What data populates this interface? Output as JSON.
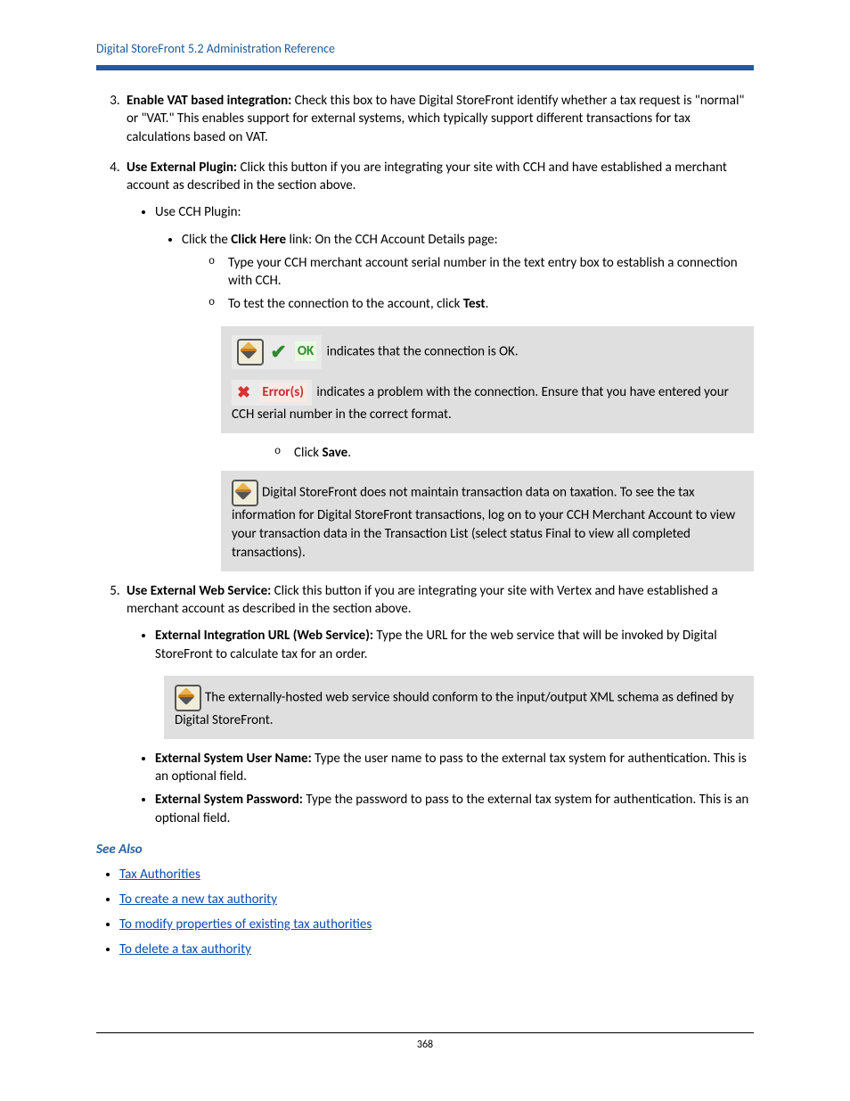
{
  "header": {
    "title": "Digital StoreFront 5.2 Administration Reference"
  },
  "item3": {
    "label": "Enable VAT based integration:",
    "text": " Check this box to have Digital StoreFront identify whether a tax request is \"normal\" or \"VAT.\" This enables support for external systems, which typically support different transactions for tax calculations based on VAT."
  },
  "item4": {
    "label": "Use External Plugin:",
    "text": " Click this button if you are integrating your site with CCH and have established a merchant account as described in the section above.",
    "sub1": "Use CCH Plugin:",
    "sub1a_pre": "Click the ",
    "sub1a_bold": "Click Here",
    "sub1a_post": " link: On the CCH Account Details page:",
    "o1": "Type your CCH merchant account serial number in the text entry box to establish a connection with CCH.",
    "o2_pre": "To test the connection to the account, click ",
    "o2_bold": "Test",
    "o2_post": ".",
    "ok_label": "OK",
    "ok_text": " indicates that the connection is OK.",
    "err_label": "Error(s)",
    "err_text": " indicates a problem with the connection. Ensure that you have entered your CCH serial number in the correct format.",
    "o3_pre": "Click ",
    "o3_bold": "Save",
    "o3_post": ".",
    "note2": "Digital StoreFront does not maintain transaction data on taxation. To see the tax information for Digital StoreFront transactions, log on to your CCH Merchant Account to view your transaction data in the Transaction List (select status Final to view all completed transactions)."
  },
  "item5": {
    "label": "Use External Web Service:",
    "text": " Click this button if you are integrating your site with Vertex and have established a merchant account as described in the section above.",
    "b1_label": "External Integration URL (Web Service):",
    "b1_text": " Type the URL for the web service that will be invoked by Digital StoreFront to calculate tax for an order.",
    "note": "The externally-hosted web service should conform to the input/output XML schema as defined by Digital StoreFront.",
    "b2_label": "External System User Name:",
    "b2_text": " Type the user name to pass to the external tax system for authentication. This is an optional field.",
    "b3_label": "External System Password:",
    "b3_text": " Type the password to pass to the external tax system for authentication. This is an optional field."
  },
  "see_also": {
    "heading": "See Also",
    "links": [
      "Tax Authorities",
      "To create a new tax authority",
      "To modify properties of existing tax authorities",
      "To delete a tax authority"
    ]
  },
  "footer": {
    "page": "368"
  }
}
